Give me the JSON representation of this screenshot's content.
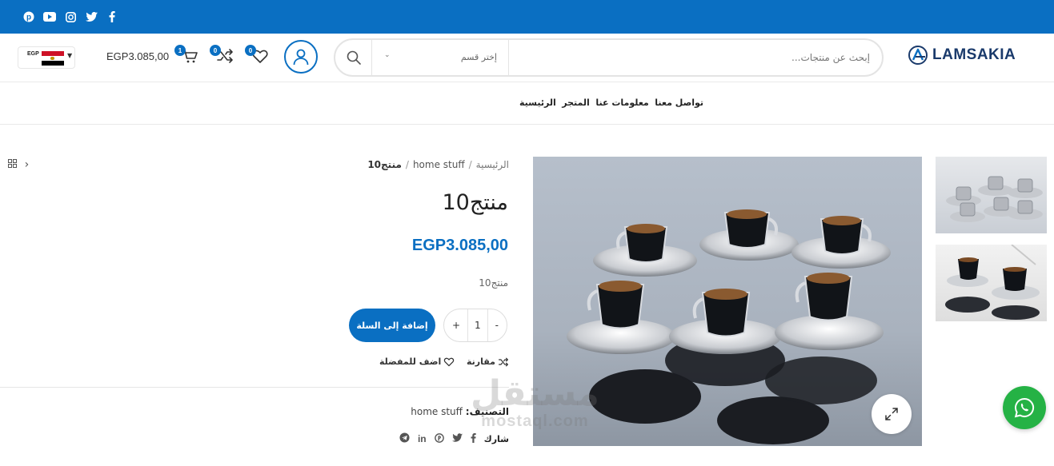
{
  "brand": {
    "name": "LAMSAKIA",
    "accent": "#0a6fc2"
  },
  "topbar": {
    "social": [
      "pinterest-icon",
      "youtube-icon",
      "instagram-icon",
      "twitter-icon",
      "facebook-icon"
    ]
  },
  "header": {
    "currency": "EGP",
    "cart_total": "EGP3.085,00",
    "cart_count": "1",
    "compare_count": "0",
    "wishlist_count": "0",
    "search": {
      "placeholder": "إبحث عن منتجات...",
      "category": "إختر قسم"
    }
  },
  "nav": {
    "items": [
      "الرئيسية",
      "المتجر",
      "معلومات عنا",
      "تواصل معنا"
    ]
  },
  "breadcrumb": {
    "home": "الرئيسية",
    "category": "home stuff",
    "current": "منتج10"
  },
  "product": {
    "title": "منتج10",
    "price": "EGP3.085,00",
    "short_description": "منتج10",
    "quantity": "1",
    "qty_minus": "-",
    "qty_plus": "+",
    "add_to_cart": "إضافة إلى السلة",
    "compare": "مقارنة",
    "wishlist": "اضف للمفضلة",
    "category_label": "التصنيف:",
    "category_value": "home stuff",
    "share_label": "شارك"
  },
  "watermark": {
    "line1": "مستقل",
    "line2": "mostaql.com"
  }
}
